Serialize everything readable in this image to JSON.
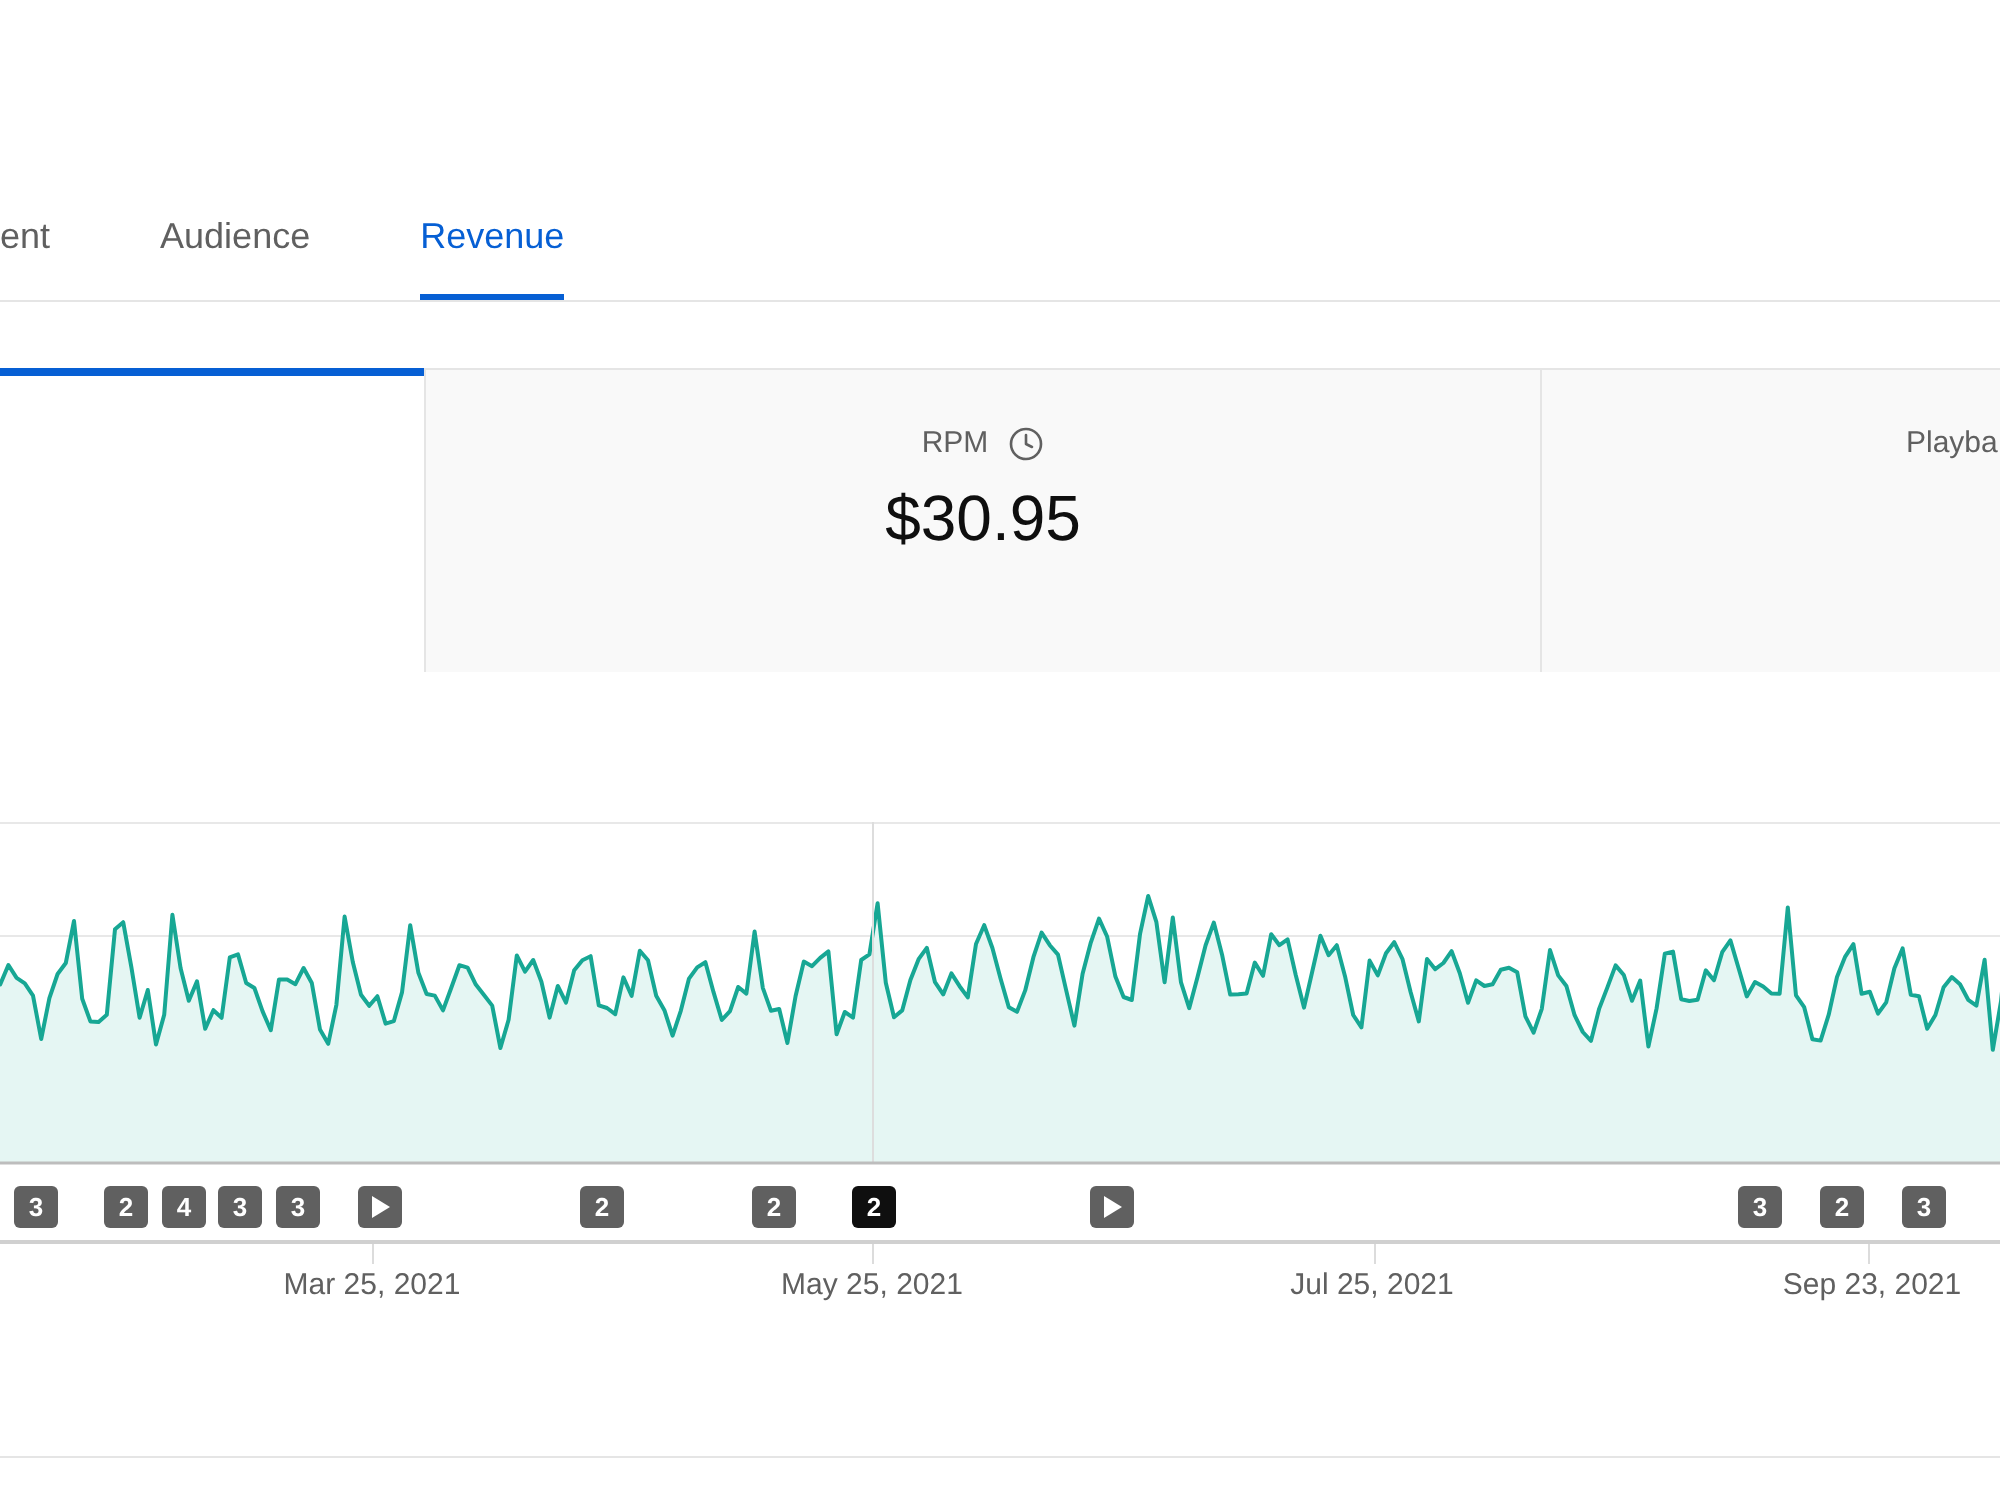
{
  "tabs": [
    {
      "label": "ent",
      "selected": false
    },
    {
      "label": "Audience",
      "selected": false
    },
    {
      "label": "Revenue",
      "selected": true
    }
  ],
  "cards": [
    {
      "selected": true
    },
    {
      "label": "RPM",
      "has_icon": true,
      "value": "$30.95",
      "selected": false
    },
    {
      "label": "Playba",
      "has_icon": false,
      "selected": false
    }
  ],
  "chart": {
    "markers": [
      {
        "kind": "count",
        "label": "3",
        "selected": false
      },
      {
        "kind": "count",
        "label": "2",
        "selected": false
      },
      {
        "kind": "count",
        "label": "4",
        "selected": false
      },
      {
        "kind": "count",
        "label": "3",
        "selected": false
      },
      {
        "kind": "count",
        "label": "3",
        "selected": false
      },
      {
        "kind": "video",
        "selected": false
      },
      {
        "kind": "count",
        "label": "2",
        "selected": false
      },
      {
        "kind": "count",
        "label": "2",
        "selected": false
      },
      {
        "kind": "count",
        "label": "2",
        "selected": true
      },
      {
        "kind": "video",
        "selected": false
      },
      {
        "kind": "count",
        "label": "3",
        "selected": false
      },
      {
        "kind": "count",
        "label": "2",
        "selected": false
      },
      {
        "kind": "count",
        "label": "3",
        "selected": false
      }
    ],
    "date_labels": [
      "Mar 25, 2021",
      "May 25, 2021",
      "Jul 25, 2021",
      "Sep 23, 2021"
    ]
  }
}
